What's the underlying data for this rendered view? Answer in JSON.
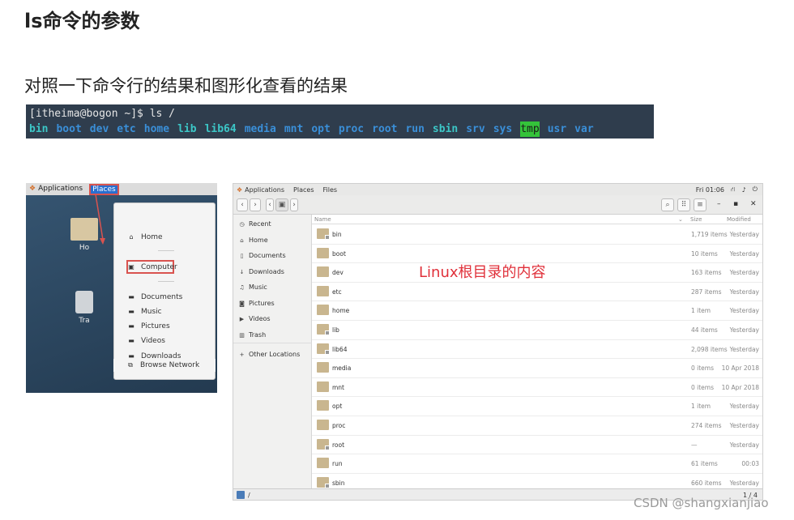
{
  "heading": "ls命令的参数",
  "subheading": "对照一下命令行的结果和图形化查看的结果",
  "terminal": {
    "prompt": "[itheima@bogon ~]$ ls /",
    "entries": [
      {
        "name": "bin",
        "kind": "lnk"
      },
      {
        "name": "boot",
        "kind": "dir"
      },
      {
        "name": "dev",
        "kind": "dir"
      },
      {
        "name": "etc",
        "kind": "dir"
      },
      {
        "name": "home",
        "kind": "dir"
      },
      {
        "name": "lib",
        "kind": "lnk"
      },
      {
        "name": "lib64",
        "kind": "lnk"
      },
      {
        "name": "media",
        "kind": "dir"
      },
      {
        "name": "mnt",
        "kind": "dir"
      },
      {
        "name": "opt",
        "kind": "dir"
      },
      {
        "name": "proc",
        "kind": "dir"
      },
      {
        "name": "root",
        "kind": "dir"
      },
      {
        "name": "run",
        "kind": "dir"
      },
      {
        "name": "sbin",
        "kind": "lnk"
      },
      {
        "name": "srv",
        "kind": "dir"
      },
      {
        "name": "sys",
        "kind": "dir"
      },
      {
        "name": "tmp",
        "kind": "tmp"
      },
      {
        "name": "usr",
        "kind": "dir"
      },
      {
        "name": "var",
        "kind": "dir"
      }
    ]
  },
  "desktop": {
    "topbar": {
      "applications": "Applications",
      "places": "Places"
    },
    "icons": [
      {
        "label": "Ho"
      },
      {
        "label": "Tra"
      }
    ],
    "places_menu": [
      {
        "label": "Home",
        "icon": "home-icon"
      },
      {
        "label": "Computer",
        "icon": "computer-icon"
      },
      {
        "label": "Documents",
        "icon": "folder-icon"
      },
      {
        "label": "Music",
        "icon": "folder-icon"
      },
      {
        "label": "Pictures",
        "icon": "folder-icon"
      },
      {
        "label": "Videos",
        "icon": "folder-icon"
      },
      {
        "label": "Downloads",
        "icon": "folder-icon"
      },
      {
        "label": "Browse Network",
        "icon": "network-icon"
      }
    ]
  },
  "files_window": {
    "topbar": {
      "applications": "Applications",
      "places": "Places",
      "files": "Files",
      "clock": "Fri 01:06"
    },
    "sidebar": [
      {
        "label": "Recent",
        "icon": "recent-icon"
      },
      {
        "label": "Home",
        "icon": "home-icon"
      },
      {
        "label": "Documents",
        "icon": "document-icon"
      },
      {
        "label": "Downloads",
        "icon": "download-icon"
      },
      {
        "label": "Music",
        "icon": "music-icon"
      },
      {
        "label": "Pictures",
        "icon": "camera-icon"
      },
      {
        "label": "Videos",
        "icon": "video-icon"
      },
      {
        "label": "Trash",
        "icon": "trash-icon"
      },
      {
        "label": "Other Locations",
        "icon": "plus-icon"
      }
    ],
    "columns": {
      "name": "Name",
      "size": "Size",
      "modified": "Modified"
    },
    "rows": [
      {
        "name": "bin",
        "size": "1,719 items",
        "modified": "Yesterday",
        "link": true
      },
      {
        "name": "boot",
        "size": "10 items",
        "modified": "Yesterday",
        "link": false
      },
      {
        "name": "dev",
        "size": "163 items",
        "modified": "Yesterday",
        "link": false
      },
      {
        "name": "etc",
        "size": "287 items",
        "modified": "Yesterday",
        "link": false
      },
      {
        "name": "home",
        "size": "1 item",
        "modified": "Yesterday",
        "link": false
      },
      {
        "name": "lib",
        "size": "44 items",
        "modified": "Yesterday",
        "link": true
      },
      {
        "name": "lib64",
        "size": "2,098 items",
        "modified": "Yesterday",
        "link": true
      },
      {
        "name": "media",
        "size": "0 items",
        "modified": "10 Apr 2018",
        "link": false
      },
      {
        "name": "mnt",
        "size": "0 items",
        "modified": "10 Apr 2018",
        "link": false
      },
      {
        "name": "opt",
        "size": "1 item",
        "modified": "Yesterday",
        "link": false
      },
      {
        "name": "proc",
        "size": "274 items",
        "modified": "Yesterday",
        "link": false
      },
      {
        "name": "root",
        "size": "—",
        "modified": "Yesterday",
        "link": true
      },
      {
        "name": "run",
        "size": "61 items",
        "modified": "00:03",
        "link": false
      },
      {
        "name": "sbin",
        "size": "660 items",
        "modified": "Yesterday",
        "link": true
      }
    ],
    "status_path": "/",
    "page_indicator": "1 / 4"
  },
  "annotation": "Linux根目录的内容",
  "watermark": "CSDN @shangxianjiao"
}
